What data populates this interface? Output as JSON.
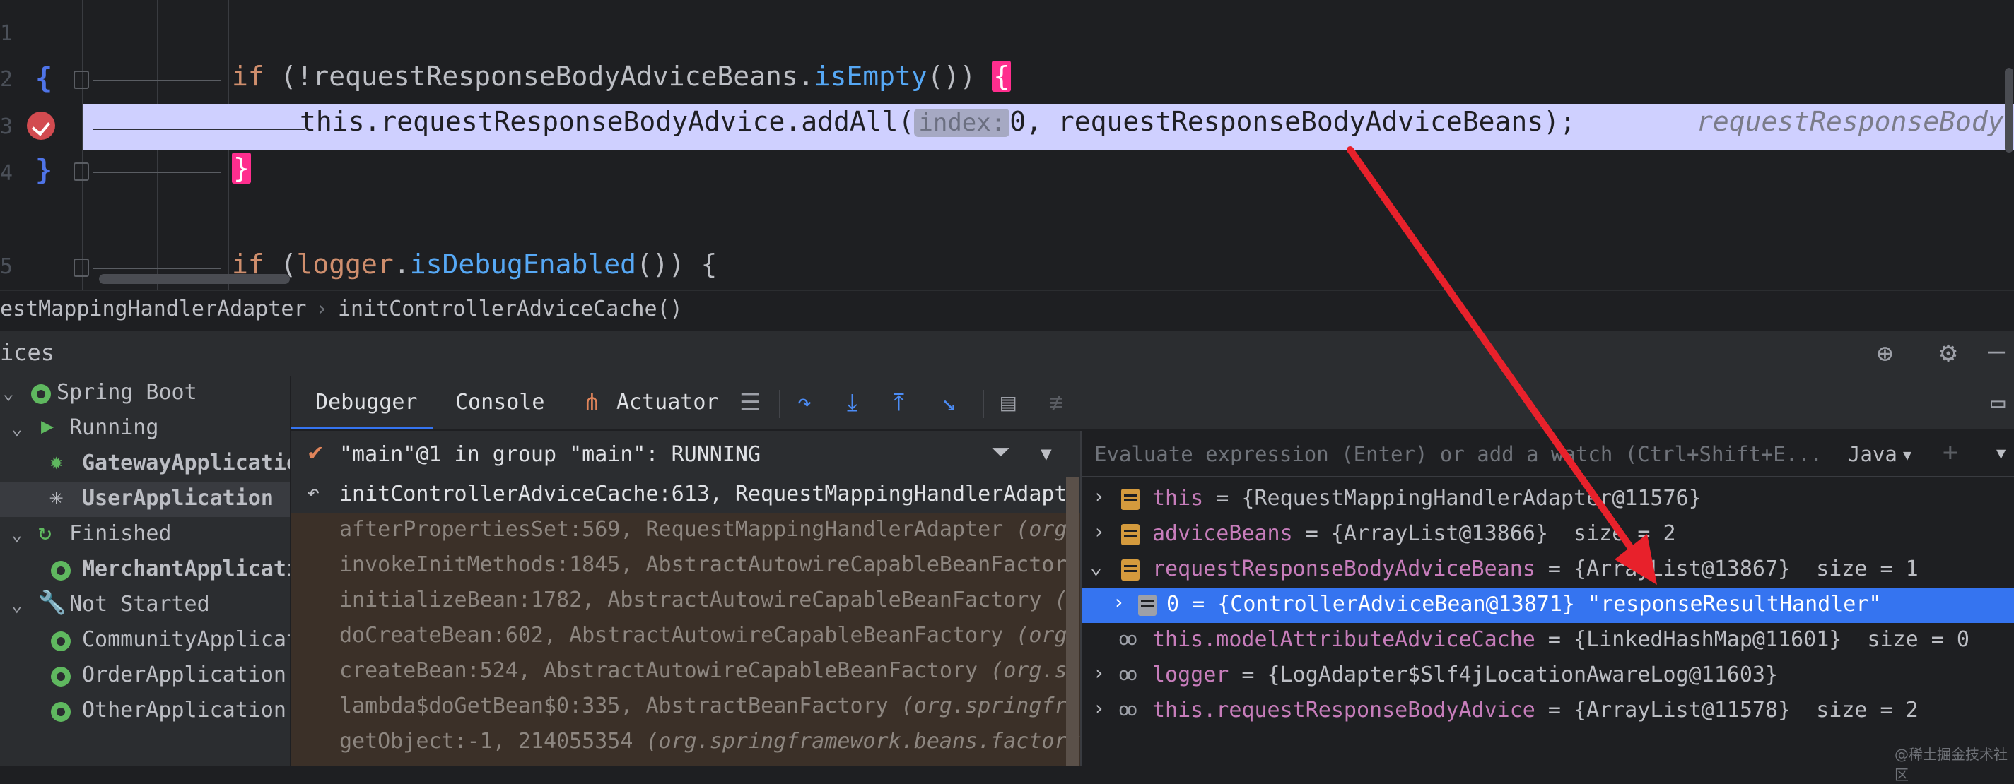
{
  "editor": {
    "line_numbers": [
      "1",
      "2",
      "3",
      "4",
      "5"
    ],
    "code": {
      "if1_kw": "if",
      "if1_prefix": " (!requestResponseBodyAdviceBeans.",
      "if1_method": "isEmpty",
      "if1_suffix": "()) ",
      "brace_open": "{",
      "brace_close": "}",
      "line2_prefix": "this.requestResponseBodyAdvice.addAll(",
      "inlay_hint": "index:",
      "line2_value": "0",
      "line2_suffix": ", requestResponseBodyAdviceBeans);",
      "line2_ghost": "requestResponseBody",
      "if2_kw": "if",
      "if2_paren": " (",
      "if2_field": "logger",
      "if2_dot": ".",
      "if2_method": "isDebugEnabled",
      "if2_suffix": "()) {"
    }
  },
  "breadcrumb": {
    "class": "estMappingHandlerAdapter",
    "separator": "›",
    "method": "initControllerAdviceCache()"
  },
  "services": {
    "title": "ices",
    "tree": [
      {
        "label": "Spring Boot",
        "level": 0,
        "expanded": true
      },
      {
        "label": "Running",
        "level": 1,
        "expanded": true
      },
      {
        "label": "GatewayApplicatio",
        "level": 2,
        "bold": true
      },
      {
        "label": "UserApplication",
        "level": 2,
        "bold": true,
        "selected": true
      },
      {
        "label": "Finished",
        "level": 1,
        "expanded": true
      },
      {
        "label": "MerchantApplicati",
        "level": 2,
        "bold": true
      },
      {
        "label": "Not Started",
        "level": 1,
        "expanded": true
      },
      {
        "label": "CommunityApplicat",
        "level": 2
      },
      {
        "label": "OrderApplication",
        "level": 2
      },
      {
        "label": "OtherApplication",
        "level": 2
      }
    ]
  },
  "debugger": {
    "tabs": [
      "Debugger",
      "Console",
      "Actuator"
    ],
    "active_tab": "Debugger",
    "thread": "\"main\"@1 in group \"main\": RUNNING",
    "frames": [
      {
        "method": "initControllerAdviceCache:613, RequestMappingHandlerAdapte",
        "pkg": ""
      },
      {
        "method": "afterPropertiesSet:569, RequestMappingHandlerAdapter ",
        "pkg": "(org."
      },
      {
        "method": "invokeInitMethods:1845, AbstractAutowireCapableBeanFactory",
        "pkg": ""
      },
      {
        "method": "initializeBean:1782, AbstractAutowireCapableBeanFactory ",
        "pkg": "(o"
      },
      {
        "method": "doCreateBean:602, AbstractAutowireCapableBeanFactory ",
        "pkg": "(org."
      },
      {
        "method": "createBean:524, AbstractAutowireCapableBeanFactory ",
        "pkg": "(org.sp"
      },
      {
        "method": "lambda$doGetBean$0:335, AbstractBeanFactory ",
        "pkg": "(org.springfra"
      },
      {
        "method": "getObject:-1, 214055354 ",
        "pkg": "(org.springframework.beans.factory"
      }
    ],
    "evaluate_placeholder": "Evaluate expression (Enter) or add a watch (Ctrl+Shift+E...",
    "language": "Java",
    "variables": [
      {
        "name": "this",
        "value": " = {RequestMappingHandlerAdapter@11576}",
        "icon": "field",
        "expandable": true
      },
      {
        "name": "adviceBeans",
        "value": " = {ArrayList@13866}  size = 2",
        "icon": "field",
        "expandable": true
      },
      {
        "name": "requestResponseBodyAdviceBeans",
        "value": " = {ArrayList@13867}  size = 1",
        "icon": "field",
        "expanded": true
      },
      {
        "name": "0",
        "value": " = {ControllerAdviceBean@13871} \"responseResultHandler\"",
        "icon": "field",
        "expandable": true,
        "selected": true,
        "child": true
      },
      {
        "name": "this.modelAttributeAdviceCache",
        "value": " = {LinkedHashMap@11601}  size = 0",
        "icon": "watch"
      },
      {
        "name": "logger",
        "value": " = {LogAdapter$Slf4jLocationAwareLog@11603}",
        "icon": "watch",
        "expandable": true
      },
      {
        "name": "this.requestResponseBodyAdvice",
        "value": " = {ArrayList@11578}  size = 2",
        "icon": "watch",
        "expandable": true
      }
    ]
  },
  "watermark": "@稀土掘金技术社区",
  "colors": {
    "arrow": "#e8212b",
    "selection": "#3574f0",
    "highlight_line": "#cfd0ff",
    "brace_pink": "#ff2e8e"
  }
}
